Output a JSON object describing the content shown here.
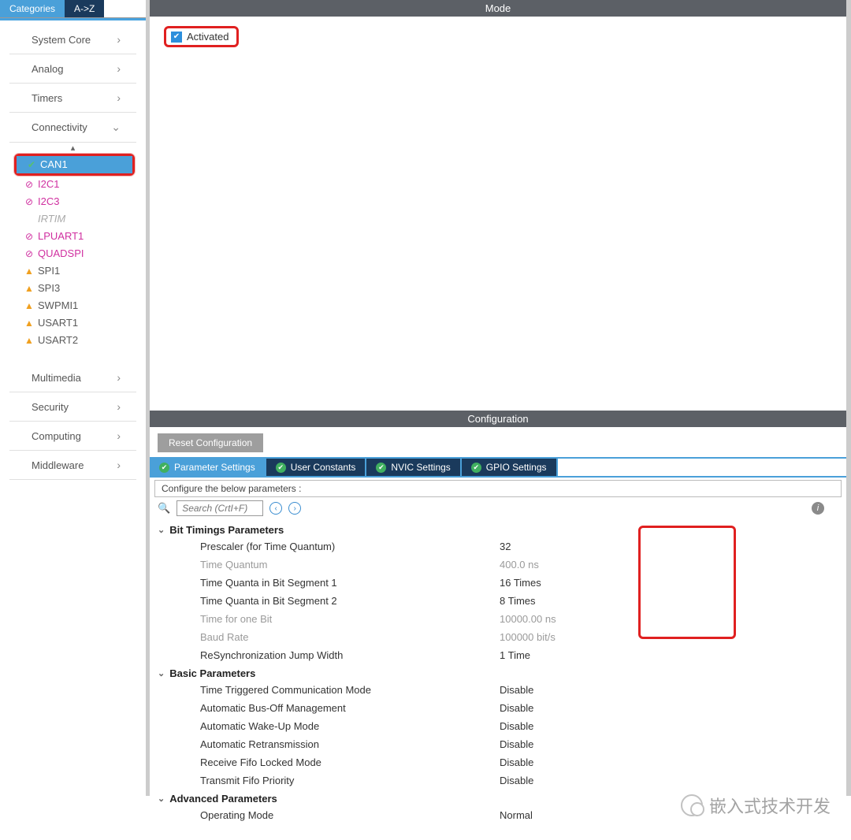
{
  "sidebar": {
    "tabs": {
      "categories": "Categories",
      "az": "A->Z"
    },
    "categories": {
      "system_core": "System Core",
      "analog": "Analog",
      "timers": "Timers",
      "connectivity": "Connectivity",
      "multimedia": "Multimedia",
      "security": "Security",
      "computing": "Computing",
      "middleware": "Middleware"
    },
    "connectivity_items": {
      "can1": {
        "label": "CAN1",
        "icon": "check",
        "state": "selected"
      },
      "i2c1": {
        "label": "I2C1",
        "icon": "forbid",
        "state": "conf"
      },
      "i2c3": {
        "label": "I2C3",
        "icon": "forbid",
        "state": "conf"
      },
      "irtim": {
        "label": "IRTIM",
        "icon": "",
        "state": "dim"
      },
      "lpuart1": {
        "label": "LPUART1",
        "icon": "forbid",
        "state": "conf"
      },
      "quadspi": {
        "label": "QUADSPI",
        "icon": "forbid",
        "state": "conf"
      },
      "spi1": {
        "label": "SPI1",
        "icon": "warn",
        "state": "warn"
      },
      "spi3": {
        "label": "SPI3",
        "icon": "warn",
        "state": "warn"
      },
      "swpmi1": {
        "label": "SWPMI1",
        "icon": "warn",
        "state": "warn"
      },
      "usart1": {
        "label": "USART1",
        "icon": "warn",
        "state": "warn"
      },
      "usart2": {
        "label": "USART2",
        "icon": "warn",
        "state": "warn"
      }
    }
  },
  "mode": {
    "title": "Mode",
    "activated_label": "Activated",
    "activated": true
  },
  "config": {
    "title": "Configuration",
    "reset_label": "Reset Configuration",
    "tabs": {
      "param": "Parameter Settings",
      "user": "User Constants",
      "nvic": "NVIC Settings",
      "gpio": "GPIO Settings"
    },
    "hint": "Configure the below parameters :",
    "search_placeholder": "Search (CrtI+F)",
    "groups": {
      "bit_timings": {
        "title": "Bit Timings Parameters",
        "rows": {
          "prescaler": {
            "label": "Prescaler (for Time Quantum)",
            "value": "32"
          },
          "tq": {
            "label": "Time Quantum",
            "value": "400.0 ns",
            "dim": true
          },
          "tqbs1": {
            "label": "Time Quanta in Bit Segment 1",
            "value": "16 Times"
          },
          "tqbs2": {
            "label": "Time Quanta in Bit Segment 2",
            "value": "8 Times"
          },
          "onebit": {
            "label": "Time for one Bit",
            "value": "10000.00 ns",
            "dim": true
          },
          "baud": {
            "label": "Baud Rate",
            "value": "100000 bit/s",
            "dim": true
          },
          "resync": {
            "label": "ReSynchronization Jump Width",
            "value": "1 Time"
          }
        }
      },
      "basic": {
        "title": "Basic Parameters",
        "rows": {
          "ttcm": {
            "label": "Time Triggered Communication Mode",
            "value": "Disable"
          },
          "abom": {
            "label": "Automatic Bus-Off Management",
            "value": "Disable"
          },
          "awum": {
            "label": "Automatic Wake-Up Mode",
            "value": "Disable"
          },
          "art": {
            "label": "Automatic Retransmission",
            "value": "Disable"
          },
          "rflm": {
            "label": "Receive Fifo Locked Mode",
            "value": "Disable"
          },
          "txfp": {
            "label": "Transmit Fifo Priority",
            "value": "Disable"
          }
        }
      },
      "advanced": {
        "title": "Advanced Parameters",
        "rows": {
          "opmode": {
            "label": "Operating Mode",
            "value": "Normal"
          }
        }
      }
    }
  },
  "watermark": "嵌入式技术开发"
}
